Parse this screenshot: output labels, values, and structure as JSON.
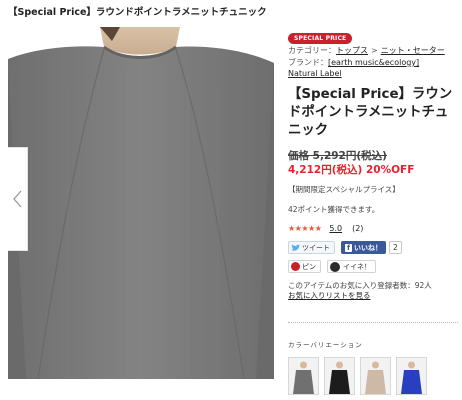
{
  "header": {
    "title": "【Special Price】ラウンドポイントラメニットチュニック"
  },
  "badge": {
    "label": "SPECIAL PRICE"
  },
  "category": {
    "label": "カテゴリー：",
    "items": [
      "トップス",
      "ニット・セーター"
    ],
    "separator": ">"
  },
  "brand": {
    "label": "ブランド：",
    "name": "[earth music&ecology] Natural Label"
  },
  "product": {
    "title": "【Special Price】ラウンドポイントラメニットチュニック",
    "old_price": "価格 5,292円(税込)",
    "new_price": "4,212円(税込) 20%OFF",
    "limited_note": "【期間限定スペシャルプライス】",
    "points": "42ポイント獲得できます。"
  },
  "rating": {
    "stars": "★★★★★",
    "score": "5.0",
    "count": "(2)"
  },
  "social": {
    "tweet_label": "ツイート",
    "like_label": "いいね！",
    "like_count": "2",
    "pin_label": "ピン",
    "iine_label": "イイネ！"
  },
  "favorites": {
    "count_text": "このアイテムのお気に入り登録者数：92人",
    "add_link": "お気に入りリストを見る"
  },
  "variation": {
    "label": "カラーバリエーション",
    "colors": [
      {
        "name": "charcoal",
        "hex": "#707070"
      },
      {
        "name": "black",
        "hex": "#1c1c1c"
      },
      {
        "name": "beige",
        "hex": "#cdb9a6"
      },
      {
        "name": "blue",
        "hex": "#2a3fbf"
      }
    ]
  },
  "theme": {
    "accent": "#c9202e",
    "sale_red": "#e8212e",
    "like_blue": "#3b5998"
  }
}
